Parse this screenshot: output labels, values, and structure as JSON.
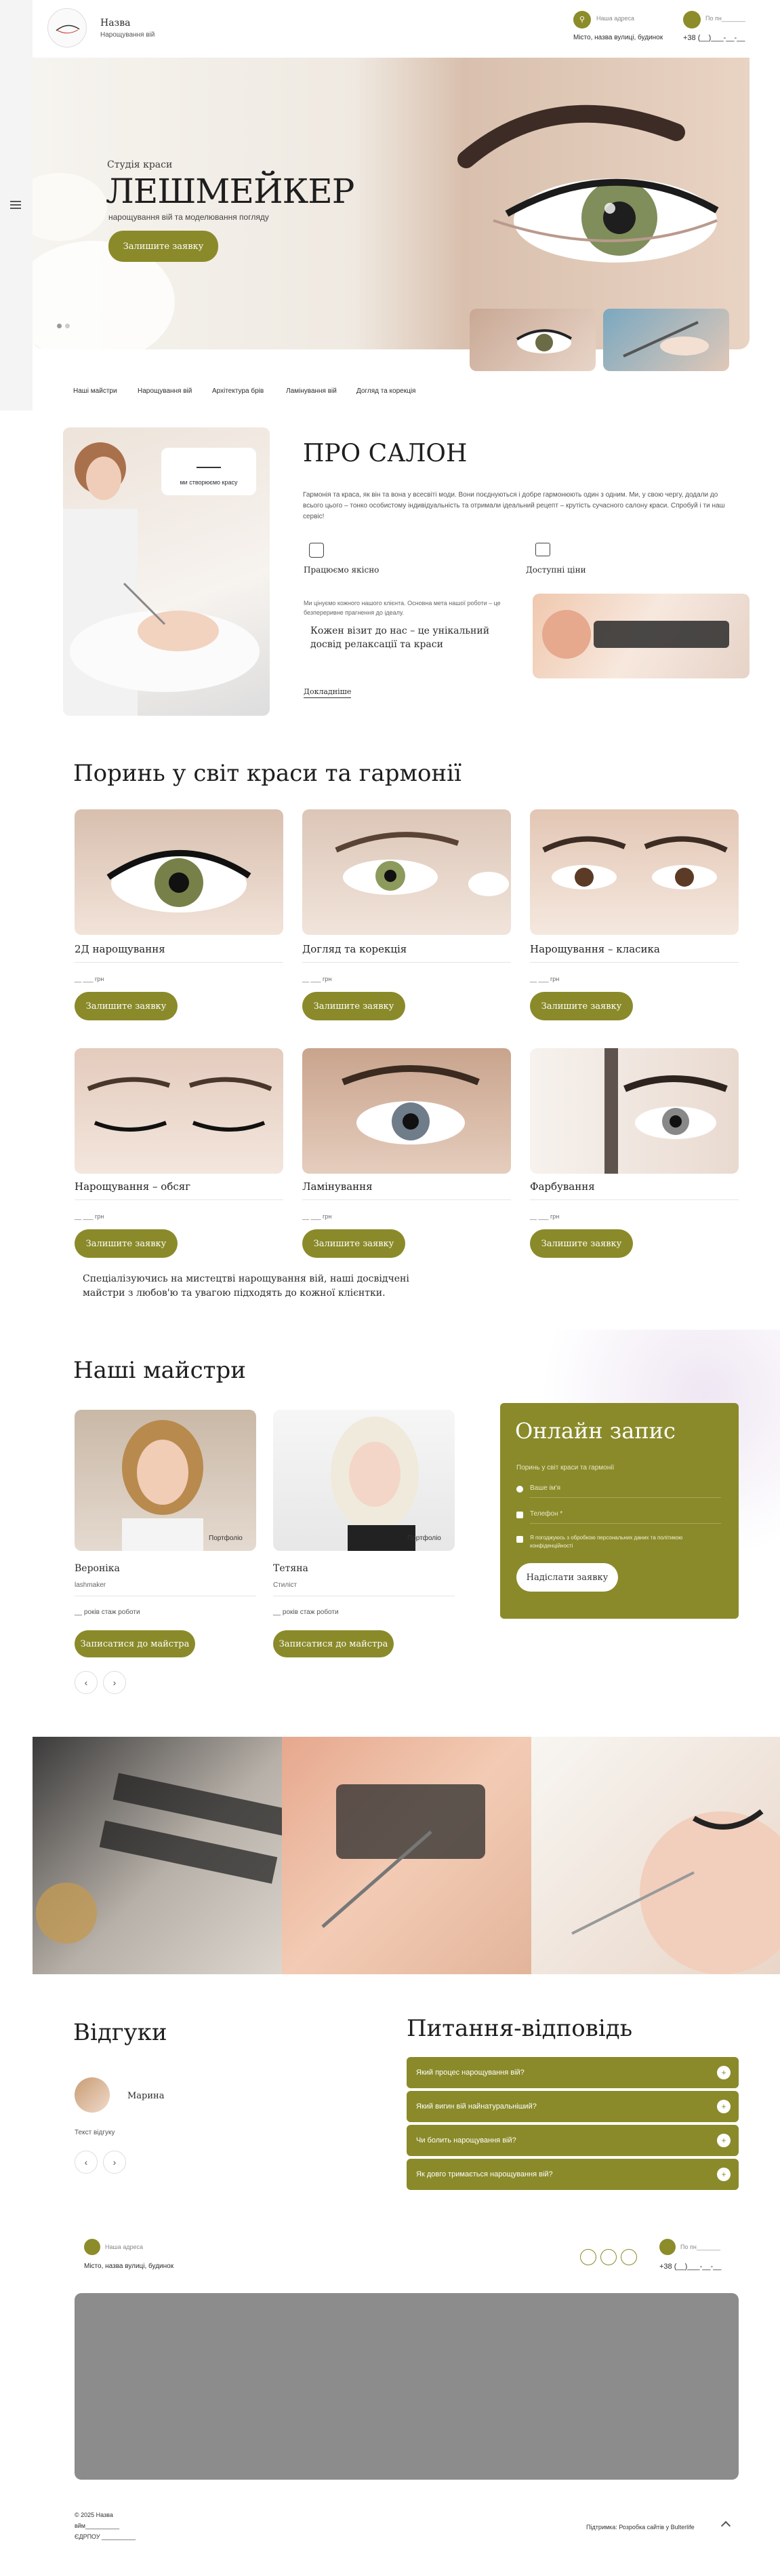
{
  "header": {
    "logo_name": "Назва",
    "logo_sub": "Нарощування вій",
    "addr_label": "Наша адреса",
    "addr_value": "Місто, назва вулиці, будинок",
    "phone_label": "По пн_______",
    "phone_value": "+38 (__)___-__-__"
  },
  "hero": {
    "eyebrow": "Студія краси",
    "title": "ЛЕШМЕЙКЕР",
    "subtitle": "нарощування вій та моделювання погляду",
    "cta": "Залишите заявку"
  },
  "nav": [
    "Наші майстри",
    "Нарощування вій",
    "Архітектура брів",
    "Ламінування вій",
    "Догляд та корекція"
  ],
  "about": {
    "badge": "ми створюємо красу",
    "title": "ПРО САЛОН",
    "text": "Гармонія та краса, як він та вона у всесвіті моди. Вони поєднуються і добре гармонюють один з одним. Ми, у свою чергу, додали до всього цього – тонко особистому індивідуальність та отримали ідеальний рецепт – крутість сучасного салону краси. Спробуй і ти наш сервіс!",
    "feature1": "Працюємо якісно",
    "feature2": "Доступні ціни",
    "quote_small": "Ми цінуємо кожного нашого клієнта. Основна мета нашої роботи – це безпереривне прагнення до ідеалу.",
    "quote": "Кожен візит до нас – це унікальний досвід релаксації та краси",
    "more": "Докладніше"
  },
  "services": {
    "title": "Поринь у світ краси та гармонії",
    "items": [
      {
        "name": "2Д нарощування",
        "price": "__ ___ грн",
        "cta": "Залишите заявку"
      },
      {
        "name": "Догляд та корекція",
        "price": "__ ___ грн",
        "cta": "Залишите заявку"
      },
      {
        "name": "Нарощування – класика",
        "price": "__ ___ грн",
        "cta": "Залишите заявку"
      },
      {
        "name": "Нарощування – обсяг",
        "price": "__ ___ грн",
        "cta": "Залишите заявку"
      },
      {
        "name": "Ламінування",
        "price": "__ ___ грн",
        "cta": "Залишите заявку"
      },
      {
        "name": "Фарбування",
        "price": "__ ___ грн",
        "cta": "Залишите заявку"
      }
    ],
    "note": "Спеціалізуючись на мистецтві нарощування вій, наші досвідчені майстри з любов'ю та увагою підходять до кожної клієнтки."
  },
  "masters": {
    "title": "Наші майстри",
    "items": [
      {
        "name": "Вероніка",
        "role": "lashmaker",
        "years": "__ років стаж роботи",
        "portfolio": "Портфоліо",
        "cta": "Записатися до майстра"
      },
      {
        "name": "Тетяна",
        "role": "Стиліст",
        "years": "__ років стаж роботи",
        "portfolio": "Портфоліо",
        "cta": "Записатися до майстра"
      }
    ]
  },
  "booking": {
    "title": "Онлайн запис",
    "subtitle": "Поринь у світ краси та гармонії",
    "name_placeholder": "Ваше ім'я",
    "phone_placeholder": "Телефон *",
    "consent": "Я погоджуюсь з обробкою персональних даних та політикою конфіденційності",
    "cta": "Надіслати заявку"
  },
  "reviews": {
    "title": "Відгуки",
    "name": "Марина",
    "text": "Текст відгуку"
  },
  "faq": {
    "title": "Питання-відповідь",
    "items": [
      "Який процес нарощування вій?",
      "Який вигин вій найнатуральніший?",
      "Чи болить нарощування вій?",
      "Як довго тримається нарощування вій?"
    ]
  },
  "footer": {
    "addr_label": "Наша адреса",
    "addr_value": "Місто, назва вулиці, будинок",
    "phone_label": "По пн_______",
    "phone_value": "+38 (__)___-__-__",
    "copyright": "© 2025 Назва",
    "line2": "вйм__________",
    "line3": "ЄДРПОУ __________",
    "dev": "Підтримка: Розробка сайтів у Bulterlife"
  },
  "colors": {
    "accent": "#8a8a2a",
    "bg": "#ffffff"
  }
}
